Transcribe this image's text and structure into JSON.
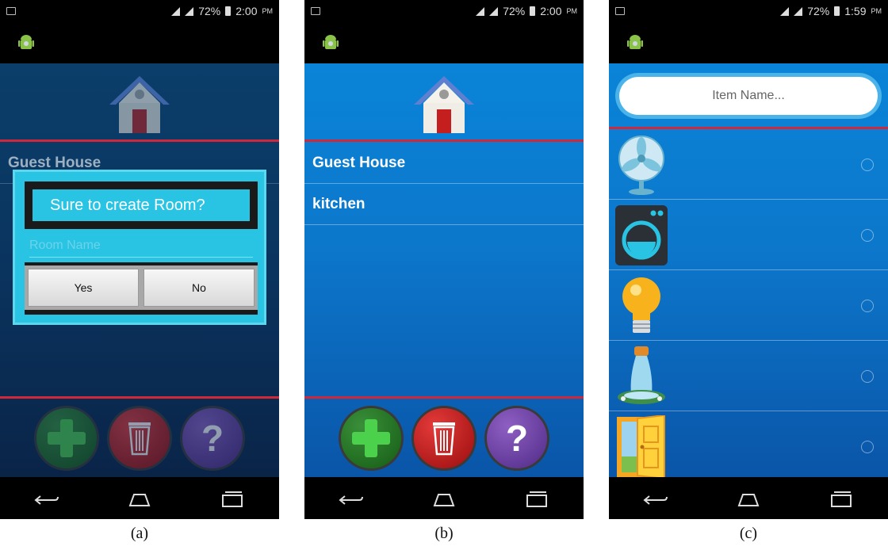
{
  "status_bar": {
    "battery": "72%",
    "am_pm": "PM",
    "time_a": "2:00",
    "time_b": "2:00",
    "time_c": "1:59"
  },
  "panel_a": {
    "rooms": [
      "Guest House"
    ],
    "dialog": {
      "title": "Sure to create Room?",
      "input_placeholder": "Room Name",
      "yes_label": "Yes",
      "no_label": "No"
    },
    "caption": "(a)"
  },
  "panel_b": {
    "rooms": [
      "Guest House",
      "kitchen"
    ],
    "caption": "(b)"
  },
  "panel_c": {
    "search_placeholder": "Item Name...",
    "items": [
      "fan-icon",
      "washing-machine-icon",
      "light-bulb-icon",
      "fountain-icon",
      "door-icon"
    ],
    "caption": "(c)"
  },
  "colors": {
    "accent_blue": "#0c77cb",
    "dialog_cyan": "#29c3e3",
    "divider_red": "#d0283a"
  }
}
